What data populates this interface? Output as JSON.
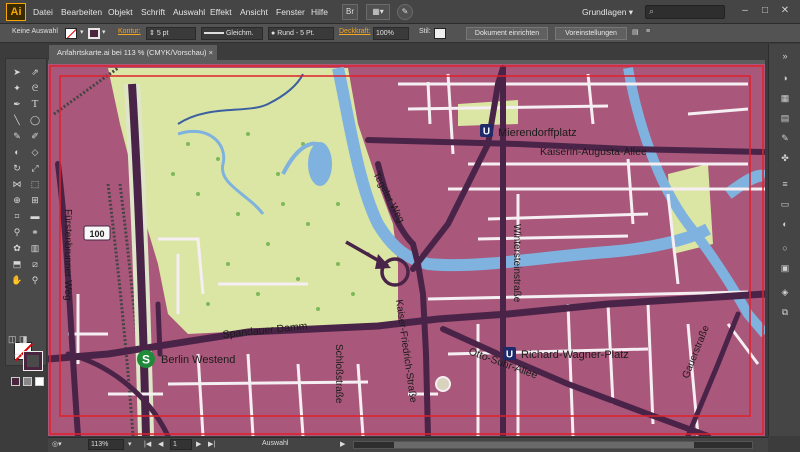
{
  "app": {
    "logo": "Ai",
    "menu": [
      "Datei",
      "Bearbeiten",
      "Objekt",
      "Schrift",
      "Auswahl",
      "Effekt",
      "Ansicht",
      "Fenster",
      "Hilfe"
    ],
    "workspace": "Grundlagen",
    "bridge_label": "Br"
  },
  "control": {
    "selection": "Keine Auswahl",
    "kontur_label": "Kontur:",
    "stroke_size": "5 pt",
    "stroke_profile": "Gleichm.",
    "brush": "Rund - 5 Pt.",
    "opacity_label": "Deckkraft:",
    "opacity": "100%",
    "style_label": "Stil:",
    "doc_setup": "Dokument einrichten",
    "preferences": "Voreinstellungen"
  },
  "document": {
    "tab_title": "Anfahrtskarte.ai bei 113 % (CMYK/Vorschau)",
    "close": "×"
  },
  "map": {
    "colors": {
      "block": "#b0607e",
      "road": "#4a2448",
      "park": "#dde8a8",
      "water": "#7fb2de",
      "frame": "#e0202a"
    },
    "labels": {
      "mierendorffplatz": "Mierendorffplatz",
      "kaiserin": "Kaiserin-Augusta-Allee",
      "tegeler": "Tegeler Weg",
      "winterstein": "Wintersteinstraße",
      "fuerstenbrunner": "Fürstenbrunner Weg",
      "spandauer": "Spandauer Damm",
      "kaiser_friedrich": "Kaiser-Friedrich-Straße",
      "schloss": "Schloßstraße",
      "otto_suhr": "Otto-Suhr-Allee",
      "richard_wagner": "Richard-Wagner-Platz",
      "gauer": "Gauerstraße",
      "berlin_westend": "Berlin Westend",
      "route": "100",
      "u_badge": "U",
      "s_badge": "S"
    }
  },
  "status": {
    "zoom": "113%",
    "page": "1",
    "tool": "Auswahl"
  }
}
